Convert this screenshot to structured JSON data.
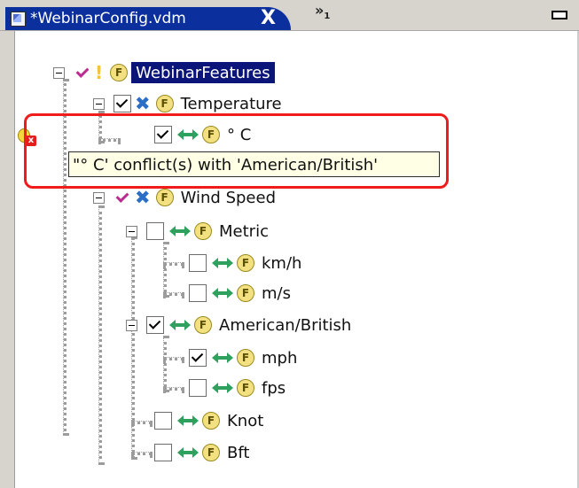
{
  "window": {
    "tab_title": "*WebinarConfig.vdm",
    "tab_close": "X",
    "overflow_label": "»",
    "overflow_count": "1"
  },
  "tooltip": "\"°  C' conflict(s) with 'American/British'",
  "tree": [
    {
      "label": "WebinarFeatures",
      "type": "root"
    },
    {
      "label": "Temperature",
      "type": "group"
    },
    {
      "label": "°  C",
      "type": "leaf-conflict"
    },
    {
      "label": "Wind Speed",
      "type": "group"
    },
    {
      "label": "Metric",
      "type": "group"
    },
    {
      "label": "km/h",
      "type": "leaf"
    },
    {
      "label": "m/s",
      "type": "leaf"
    },
    {
      "label": "American/British",
      "type": "group"
    },
    {
      "label": "mph",
      "type": "leaf"
    },
    {
      "label": "fps",
      "type": "leaf"
    },
    {
      "label": "Knot",
      "type": "leaf"
    },
    {
      "label": "Bft",
      "type": "leaf"
    }
  ],
  "icons": {
    "feature": "F"
  },
  "colors": {
    "selection": "#0b1478",
    "tab": "#0b2f9d",
    "highlight": "#f01b1b"
  }
}
